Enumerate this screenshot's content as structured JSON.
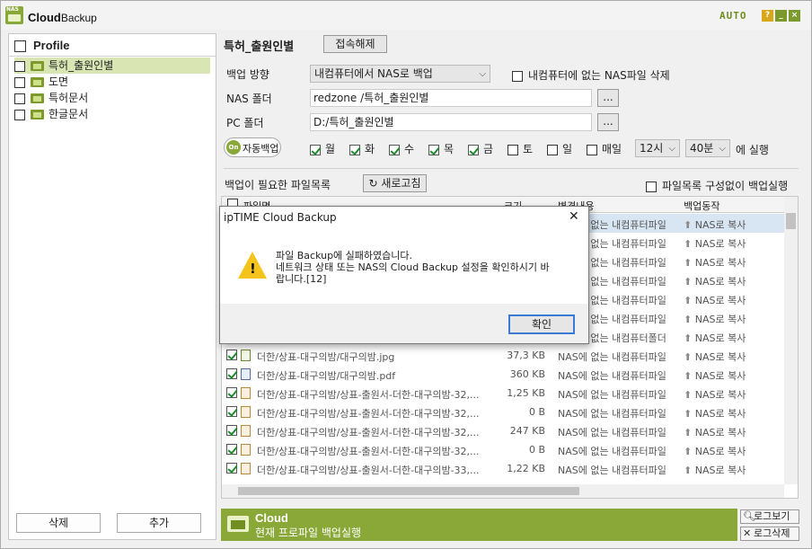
{
  "app": {
    "title_main": "Cloud",
    "title_sub": "Backup",
    "logo_text": "NAS",
    "auto_label": "AUTO",
    "help": "?",
    "min": "_",
    "close": "×"
  },
  "left": {
    "header": "Profile",
    "profiles": [
      "특허_출원인별",
      "도면",
      "특허문서",
      "한글문서"
    ],
    "delete_btn": "삭제",
    "add_btn": "추가"
  },
  "profile": {
    "name": "특허_출원인별",
    "disconnect_btn": "접속해제"
  },
  "settings": {
    "direction_label": "백업 방향",
    "direction_value": "내컴퓨터에서 NAS로 백업",
    "delete_option": "내컴퓨터에 없는 NAS파일 삭제",
    "nas_label": "NAS 폴더",
    "nas_value": "redzone /특허_출원인별",
    "pc_label": "PC 폴더",
    "pc_value": "D:/특허_출원인별",
    "browse": "...",
    "auto_on": "On",
    "auto_label": "자동백업",
    "days": [
      "월",
      "화",
      "수",
      "목",
      "금",
      "토",
      "일",
      "매일"
    ],
    "days_checked": [
      true,
      true,
      true,
      true,
      true,
      false,
      false,
      false
    ],
    "hour": "12시",
    "minute": "40분",
    "run_suffix": "에 실행"
  },
  "filelist": {
    "label": "백업이 필요한 파일목록",
    "refresh": "새로고침",
    "no_list_option": "파일목록 구성없이 백업실행",
    "columns": [
      "파일명",
      "크기",
      "변경내용",
      "백업동작"
    ],
    "rows": [
      {
        "name": "",
        "size": "",
        "status": "NAS에 없는 내컴퓨터파일",
        "action": "NAS로 복사",
        "icon": "img"
      },
      {
        "name": "",
        "size": "",
        "status": "NAS에 없는 내컴퓨터파일",
        "action": "NAS로 복사",
        "icon": "img"
      },
      {
        "name": "",
        "size": "",
        "status": "NAS에 없는 내컴퓨터파일",
        "action": "NAS로 복사",
        "icon": "img"
      },
      {
        "name": "",
        "size": "",
        "status": "NAS에 없는 내컴퓨터파일",
        "action": "NAS로 복사",
        "icon": "img"
      },
      {
        "name": "",
        "size": "",
        "status": "NAS에 없는 내컴퓨터파일",
        "action": "NAS로 복사",
        "icon": "img"
      },
      {
        "name": "",
        "size": "",
        "status": "NAS에 없는 내컴퓨터파일",
        "action": "NAS로 복사",
        "icon": "img"
      },
      {
        "name": "",
        "size": "",
        "status": "NAS에 없는 내컴퓨터폴더",
        "action": "NAS로 복사",
        "icon": "doc"
      },
      {
        "name": "더한/상표-대구의밤/대구의밤.jpg",
        "size": "37,3 KB",
        "status": "NAS에 없는 내컴퓨터파일",
        "action": "NAS로 복사",
        "icon": "img"
      },
      {
        "name": "더한/상표-대구의밤/대구의밤.pdf",
        "size": "360 KB",
        "status": "NAS에 없는 내컴퓨터파일",
        "action": "NAS로 복사",
        "icon": "pdf"
      },
      {
        "name": "더한/상표-대구의밤/상표-출원서-더한-대구의밤-32,...",
        "size": "1,25 KB",
        "status": "NAS에 없는 내컴퓨터파일",
        "action": "NAS로 복사",
        "icon": "doc"
      },
      {
        "name": "더한/상표-대구의밤/상표-출원서-더한-대구의밤-32,...",
        "size": "0 B",
        "status": "NAS에 없는 내컴퓨터파일",
        "action": "NAS로 복사",
        "icon": "doc"
      },
      {
        "name": "더한/상표-대구의밤/상표-출원서-더한-대구의밤-32,...",
        "size": "247 KB",
        "status": "NAS에 없는 내컴퓨터파일",
        "action": "NAS로 복사",
        "icon": "doc"
      },
      {
        "name": "더한/상표-대구의밤/상표-출원서-더한-대구의밤-32,...",
        "size": "0 B",
        "status": "NAS에 없는 내컴퓨터파일",
        "action": "NAS로 복사",
        "icon": "doc"
      },
      {
        "name": "더한/상표-대구의밤/상표-출원서-더한-대구의밤-33,...",
        "size": "1,22 KB",
        "status": "NAS에 없는 내컴퓨터파일",
        "action": "NAS로 복사",
        "icon": "doc"
      }
    ]
  },
  "status": {
    "line1": "Cloud",
    "line2": "현재 프로파일 백업실행"
  },
  "side_buttons": {
    "log_view": "로그보기",
    "log_delete": "로그삭제"
  },
  "dialog": {
    "title": "ipTIME Cloud Backup",
    "line1": "파일 Backup에 실패하였습니다.",
    "line2": "네트워크 상태 또는 NAS의 Cloud Backup 설정을 확인하시기 바",
    "line3": "랍니다.[12]",
    "ok": "확인"
  }
}
